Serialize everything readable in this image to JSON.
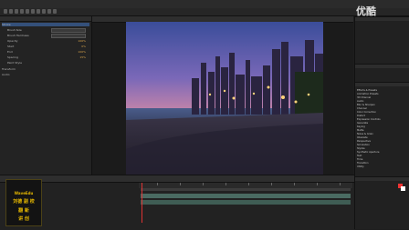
{
  "app": {
    "accent": "#34507a",
    "keyframe_color": "#d8a34a",
    "playhead_color": "#dd3333"
  },
  "watermark": {
    "text": "优酷"
  },
  "logo": {
    "line1": "WaveEdu",
    "line2": "刘德 副 校",
    "line3": "翻 新",
    "line4": "讲 创"
  },
  "left_panel": {
    "rows": [
      {
        "label": "Stroke",
        "value": ""
      },
      {
        "label": "Brush Size",
        "value": "6.4"
      },
      {
        "label": "Brush Hardness",
        "value": "30%"
      },
      {
        "label": "Opacity",
        "value": "100%"
      },
      {
        "label": "Start",
        "value": "0%"
      },
      {
        "label": "End",
        "value": "100%"
      },
      {
        "label": "Spacing",
        "value": "15%"
      },
      {
        "label": "Paint Style",
        "value": ""
      },
      {
        "label": "Transform",
        "value": ""
      },
      {
        "label": "Audio",
        "value": ""
      }
    ]
  },
  "right_panel": {
    "items": [
      "Effects & Presets",
      "Animation Presets",
      "3D Channel",
      "Audio",
      "Blur & Sharpen",
      "Channel",
      "Color Correction",
      "Distort",
      "Expression Controls",
      "Generate",
      "Keying",
      "Matte",
      "Noise & Grain",
      "Obsolete",
      "Perspective",
      "Simulation",
      "Stylize",
      "Synthetic Aperture",
      "Text",
      "Time",
      "Transition",
      "Utility"
    ]
  }
}
